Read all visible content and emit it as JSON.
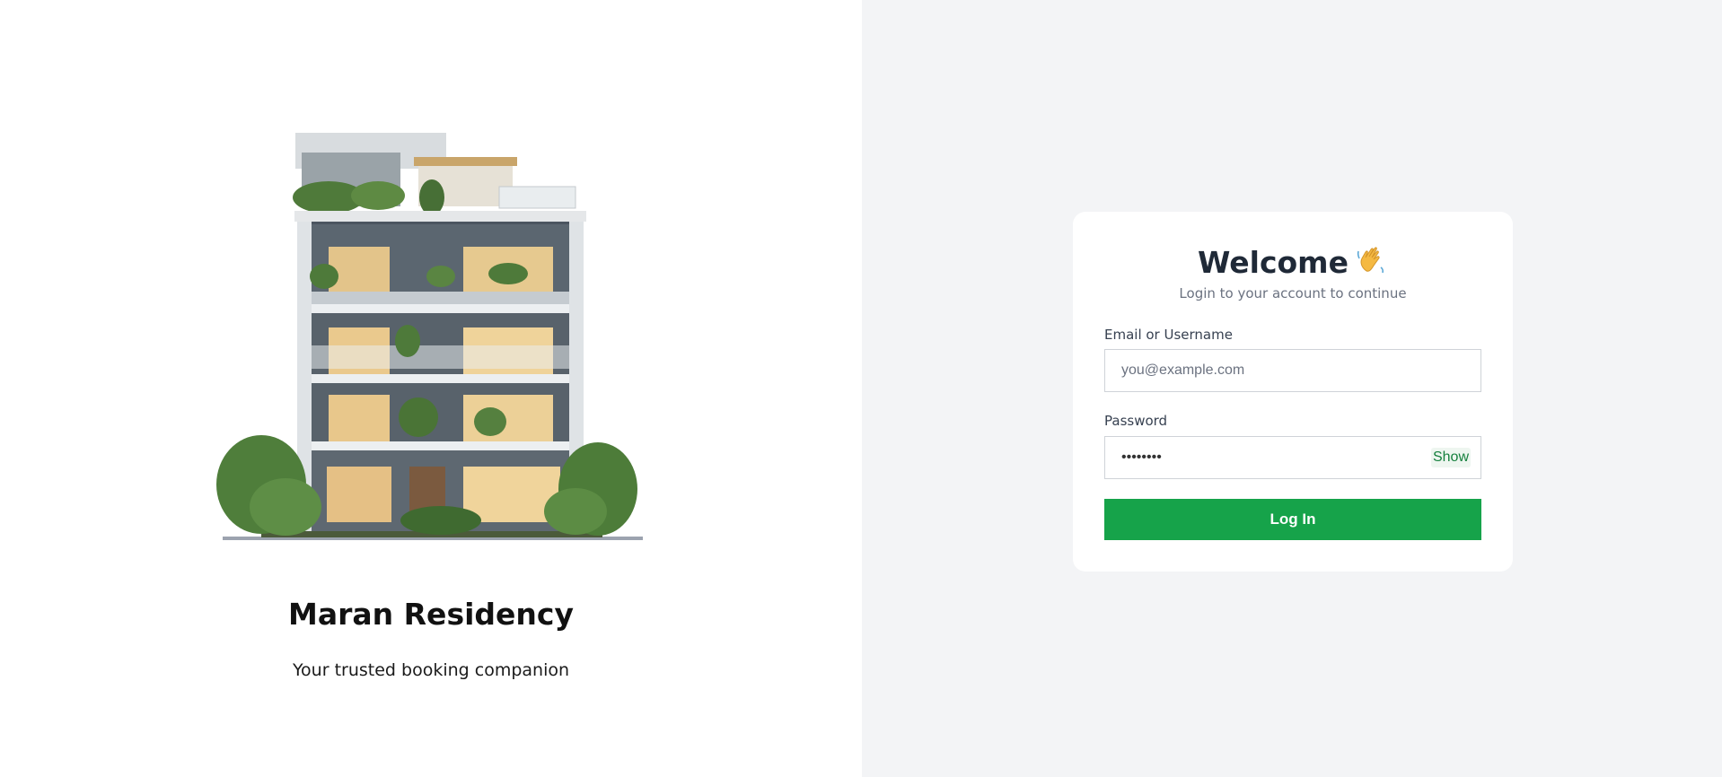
{
  "brand": {
    "name": "Maran Residency",
    "tagline": "Your trusted booking companion"
  },
  "login": {
    "heading": "Welcome",
    "heading_icon": "waving-hand-icon",
    "subtitle": "Login to your account to continue",
    "email_label": "Email or Username",
    "email_placeholder": "you@example.com",
    "password_label": "Password",
    "password_value": "••••••••",
    "show_label": "Show",
    "submit_label": "Log In"
  },
  "colors": {
    "accent": "#16a34a",
    "page_bg_right": "#f3f4f6",
    "heading": "#1f2937",
    "subtitle": "#6b7280"
  }
}
